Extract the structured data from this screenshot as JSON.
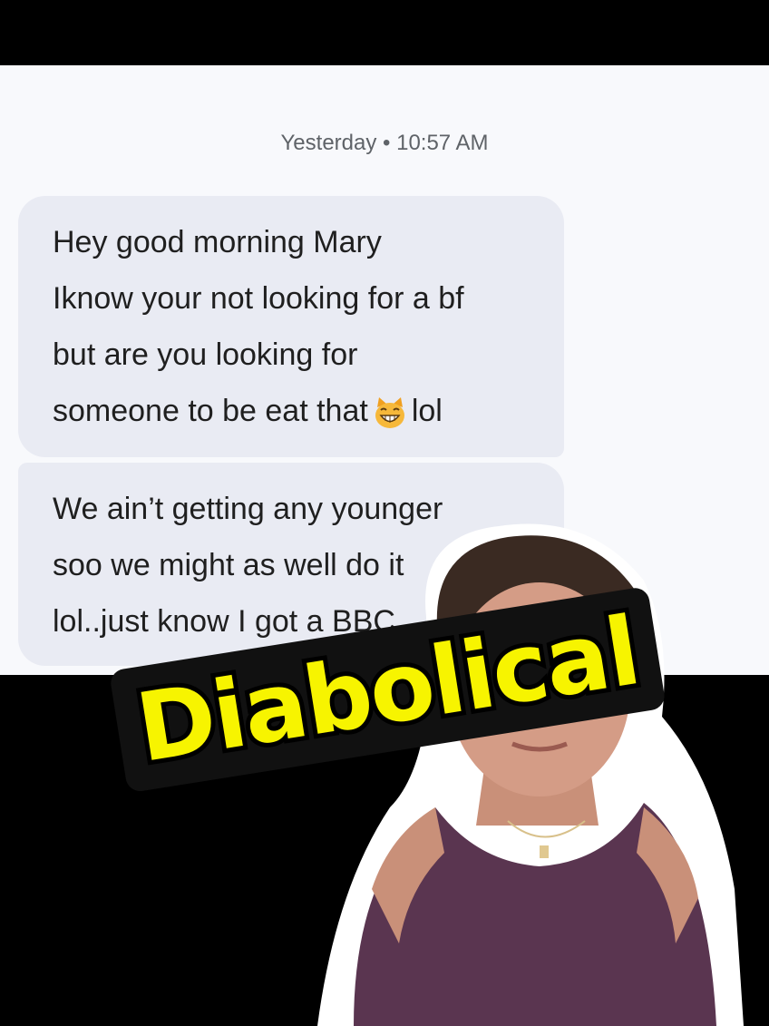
{
  "conversation": {
    "timestamp": "Yesterday • 10:57 AM",
    "messages": [
      {
        "lines": [
          "Hey good morning Mary",
          "Iknow your not looking for a bf",
          "but are you looking for",
          "someone to be eat that"
        ],
        "emoji": "grinning-cat-icon",
        "after_emoji": "lol"
      },
      {
        "lines": [
          "We ain’t getting any younger",
          "soo we might as well do it",
          "lol..just know I got a BBC"
        ]
      }
    ]
  },
  "overlay": {
    "caption": "Diabolical",
    "caption_color": "#f7f400"
  },
  "colors": {
    "bubble": "#e9ebf3",
    "screen_bg": "#f8f9fc",
    "frame": "#000000"
  }
}
